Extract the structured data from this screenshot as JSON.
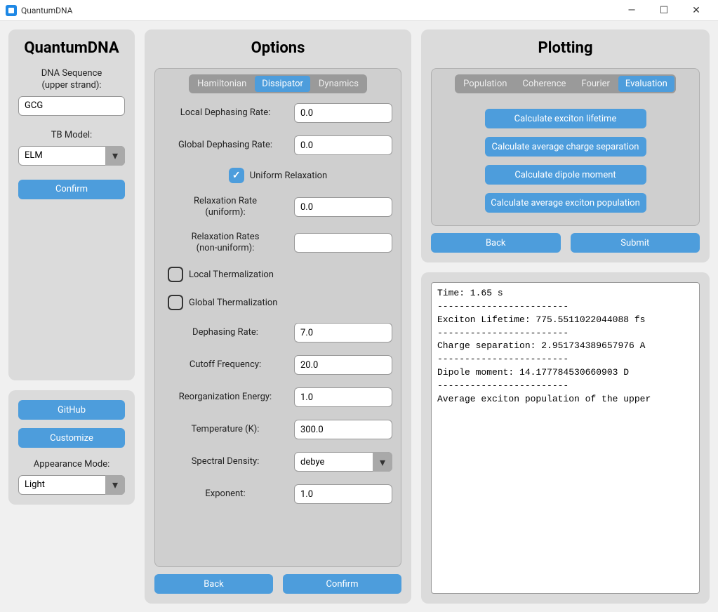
{
  "window": {
    "title": "QuantumDNA"
  },
  "sidebar": {
    "heading": "QuantumDNA",
    "dna_label": "DNA Sequence\n(upper strand):",
    "dna_value": "GCG",
    "tb_label": "TB Model:",
    "tb_value": "ELM",
    "confirm_label": "Confirm",
    "github_label": "GitHub",
    "customize_label": "Customize",
    "appearance_label": "Appearance Mode:",
    "appearance_value": "Light"
  },
  "options": {
    "heading": "Options",
    "tabs": [
      "Hamiltonian",
      "Dissipator",
      "Dynamics"
    ],
    "active_tab": 1,
    "fields": {
      "local_dephasing_label": "Local Dephasing Rate:",
      "local_dephasing_value": "0.0",
      "global_dephasing_label": "Global Dephasing Rate:",
      "global_dephasing_value": "0.0",
      "uniform_relax_label": "Uniform Relaxation",
      "uniform_relax_checked": true,
      "relax_rate_uniform_label": "Relaxation Rate\n(uniform):",
      "relax_rate_uniform_value": "0.0",
      "relax_rates_nonuniform_label": "Relaxation Rates\n(non-uniform):",
      "relax_rates_nonuniform_value": "",
      "local_therm_label": "Local Thermalization",
      "local_therm_checked": false,
      "global_therm_label": "Global Thermalization",
      "global_therm_checked": false,
      "dephasing_rate_label": "Dephasing Rate:",
      "dephasing_rate_value": "7.0",
      "cutoff_freq_label": "Cutoff Frequency:",
      "cutoff_freq_value": "20.0",
      "reorg_energy_label": "Reorganization Energy:",
      "reorg_energy_value": "1.0",
      "temperature_label": "Temperature (K):",
      "temperature_value": "300.0",
      "spectral_density_label": "Spectral Density:",
      "spectral_density_value": "debye",
      "exponent_label": "Exponent:",
      "exponent_value": "1.0"
    },
    "back_label": "Back",
    "confirm_label": "Confirm"
  },
  "plotting": {
    "heading": "Plotting",
    "tabs": [
      "Population",
      "Coherence",
      "Fourier",
      "Evaluation"
    ],
    "active_tab": 3,
    "buttons": {
      "exciton_lifetime": "Calculate exciton lifetime",
      "charge_separation": "Calculate average charge separation",
      "dipole_moment": "Calculate dipole moment",
      "exciton_population": "Calculate average exciton population"
    },
    "back_label": "Back",
    "submit_label": "Submit"
  },
  "output": {
    "text": "Time: 1.65 s\n------------------------\nExciton Lifetime: 775.5511022044088 fs\n------------------------\nCharge separation: 2.951734389657976 A\n------------------------\nDipole moment: 14.177784530660903 D\n------------------------\nAverage exciton population of the upper"
  }
}
